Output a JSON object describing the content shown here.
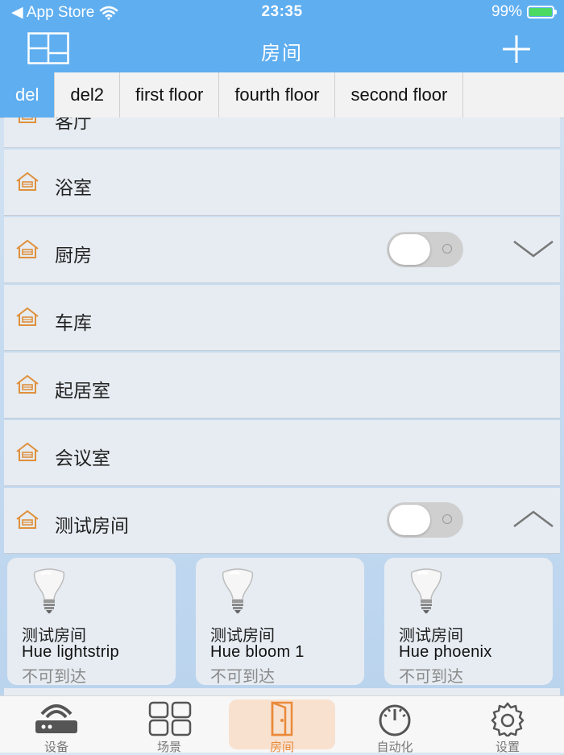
{
  "status_bar": {
    "back_label": "◀ App Store",
    "time": "23:35",
    "battery": "99%",
    "battery_level": 0.99
  },
  "header": {
    "title": "房间"
  },
  "floor_tabs": [
    {
      "label": "del",
      "active": true
    },
    {
      "label": "del2",
      "active": false
    },
    {
      "label": "first floor",
      "active": false
    },
    {
      "label": "fourth floor",
      "active": false
    },
    {
      "label": "second floor",
      "active": false
    }
  ],
  "rooms": [
    {
      "name": "客厅",
      "has_toggle": false,
      "toggle_on": false,
      "chevron": ""
    },
    {
      "name": "浴室",
      "has_toggle": false,
      "toggle_on": false,
      "chevron": ""
    },
    {
      "name": "厨房",
      "has_toggle": true,
      "toggle_on": false,
      "chevron": "chevron-down-icon"
    },
    {
      "name": "车库",
      "has_toggle": false,
      "toggle_on": false,
      "chevron": ""
    },
    {
      "name": "起居室",
      "has_toggle": false,
      "toggle_on": false,
      "chevron": ""
    },
    {
      "name": "会议室",
      "has_toggle": false,
      "toggle_on": false,
      "chevron": ""
    },
    {
      "name": "测试房间",
      "has_toggle": true,
      "toggle_on": false,
      "chevron": "chevron-up-icon"
    }
  ],
  "devices": [
    {
      "room": "测试房间",
      "name": "Hue lightstrip",
      "status": "不可到达",
      "icon": "bulb-icon"
    },
    {
      "room": "测试房间",
      "name": "Hue bloom 1",
      "status": "不可到达",
      "icon": "bulb-icon"
    },
    {
      "room": "测试房间",
      "name": "Hue phoenix",
      "status": "不可到达",
      "icon": "bulb-icon"
    }
  ],
  "tab_bar": [
    {
      "label": "设备",
      "icon": "router-icon",
      "active": false
    },
    {
      "label": "场景",
      "icon": "scenes-grid-icon",
      "active": false
    },
    {
      "label": "房间",
      "icon": "door-icon",
      "active": true
    },
    {
      "label": "自动化",
      "icon": "gauge-icon",
      "active": false
    },
    {
      "label": "设置",
      "icon": "gear-icon",
      "active": false
    }
  ],
  "colors": {
    "accent": "#5faef0",
    "active_tab": "#e98a3a",
    "room_icon": "#e0903c"
  }
}
